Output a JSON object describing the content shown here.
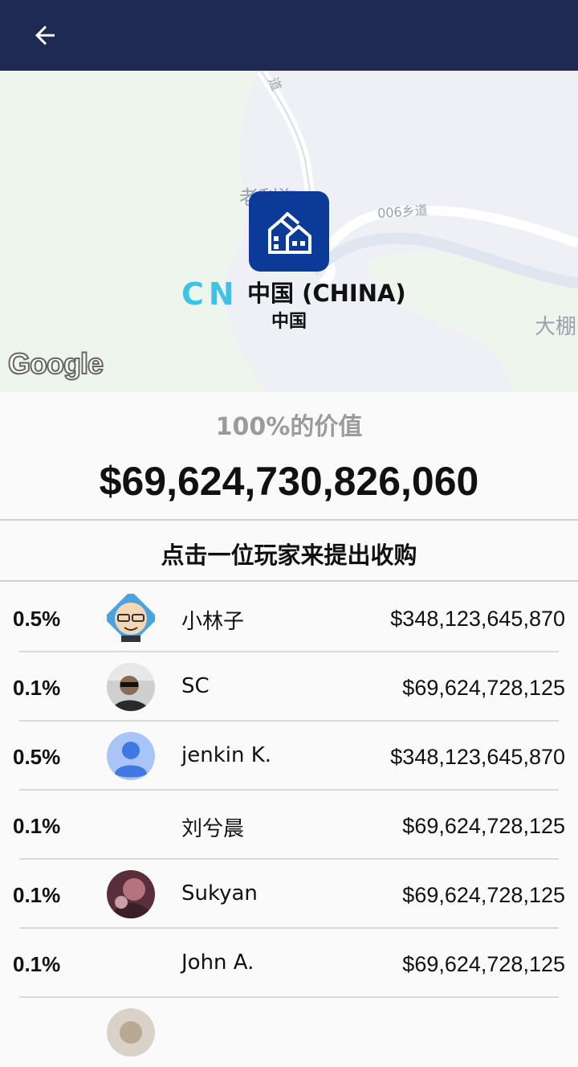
{
  "header": {
    "back_icon": "arrow-left-icon",
    "bar_color": "#1e2a54"
  },
  "map": {
    "labels": [
      "老利沟",
      "006乡道",
      "大棚",
      "道"
    ],
    "marker_icon": "building-icon",
    "country_code": "CN",
    "country_name": "中国 (CHINA)",
    "country_sub": "中国",
    "attribution": "Google"
  },
  "valuation": {
    "label": "100%的价值",
    "amount": "$69,624,730,826,060"
  },
  "prompt": "点击一位玩家来提出收购",
  "players": [
    {
      "pct": "0.5%",
      "name": "小林子",
      "amount": "$348,123,645,870",
      "avatar": "cartoon-avatar"
    },
    {
      "pct": "0.1%",
      "name": "SC",
      "amount": "$69,624,728,125",
      "avatar": "photo-avatar"
    },
    {
      "pct": "0.5%",
      "name": "jenkin K.",
      "amount": "$348,123,645,870",
      "avatar": "default-avatar"
    },
    {
      "pct": "0.1%",
      "name": "刘兮晨",
      "amount": "$69,624,728,125",
      "avatar": "none"
    },
    {
      "pct": "0.1%",
      "name": "Sukyan",
      "amount": "$69,624,728,125",
      "avatar": "photo-avatar"
    },
    {
      "pct": "0.1%",
      "name": "John A.",
      "amount": "$69,624,728,125",
      "avatar": "none"
    }
  ],
  "colors": {
    "accent_cc": "#3cc3e6",
    "marker_bg": "#0c3a99"
  }
}
